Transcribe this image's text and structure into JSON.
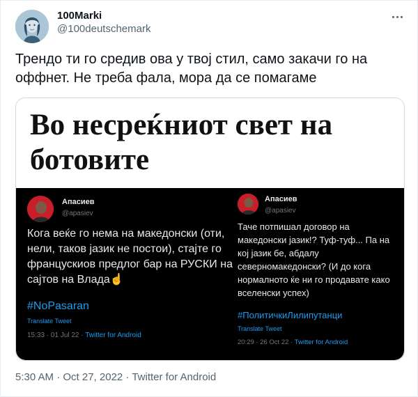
{
  "tweet": {
    "display_name": "100Marki",
    "handle": "@100deutschemark",
    "text": "Трендо ти го средив ова у твој стил, само закачи го на оффнет. Не треба фала, мора да се помагаме",
    "posted_time": "5:30 AM · Oct 27, 2022 · ",
    "source": "Twitter for Android",
    "icons": {
      "more": "more-options-icon"
    }
  },
  "media": {
    "headline": "Во несреќниот свет на ботовите",
    "embeds": [
      {
        "name": "Апасиев",
        "handle": "@apasiev",
        "text": "Кога веќе го нема на македонски (оти, нели, таков јазик не постои), стајте го францускиов предлог бар на РУСКИ на сајтов на Влада",
        "emoji": "☝",
        "hashtag": "#NoPasaran",
        "translate": "Translate Tweet",
        "meta": "15:33 · 01 Jul 22 · ",
        "source": "Twitter for Android"
      },
      {
        "name": "Апасиев",
        "handle": "@apasiev",
        "text": "Таче потпишал договор на македонски јазик!? Туф-туф... Па на кој јазик бе, абдалу северномакедонски? (И до кога нормалното ќе ни го продавате како вселенски успех)",
        "hashtag": "#ПолитичкиЛилипутанци",
        "translate": "Translate Tweet",
        "meta": "20:29 · 26 Oct 22 · ",
        "source": "Twitter for Android"
      }
    ]
  }
}
